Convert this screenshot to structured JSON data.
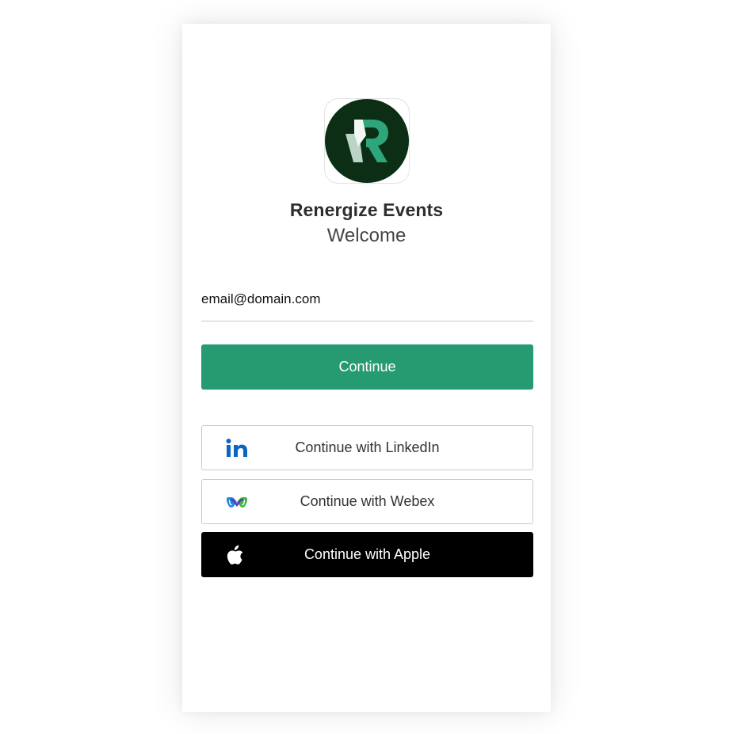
{
  "app": {
    "name": "Renergize Events",
    "welcome": "Welcome"
  },
  "login": {
    "email_value": "email@domain.com",
    "continue_label": "Continue"
  },
  "social": [
    {
      "label": "Continue with LinkedIn",
      "icon": "linkedin-icon"
    },
    {
      "label": "Continue with Webex",
      "icon": "webex-icon"
    },
    {
      "label": "Continue with Apple",
      "icon": "apple-icon"
    }
  ],
  "colors": {
    "primary": "#269b72",
    "logo_background": "#0b2e14",
    "linkedin": "#0a66c2",
    "apple_button": "#000000"
  }
}
